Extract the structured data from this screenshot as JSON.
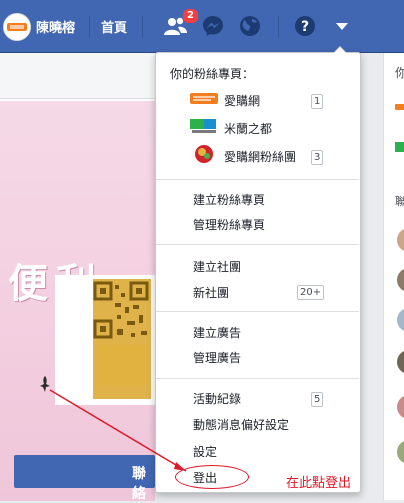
{
  "topbar": {
    "user_name": "陳曉榕",
    "home_label": "首頁",
    "friend_request_count": "2",
    "icons": [
      "friends-icon",
      "messenger-icon",
      "globe-icon",
      "help-icon",
      "dropdown-arrow-icon"
    ],
    "bg_color": "#4267b2"
  },
  "main": {
    "banner_text": "便利 ",
    "button_label": "聯絡"
  },
  "right_sidebar": {
    "header_char": "你",
    "section_char": "聯"
  },
  "menu": {
    "pages_heading": "你的粉絲專頁：",
    "pages": [
      {
        "name": "愛購網",
        "count": "1",
        "logo_text": "愛購網"
      },
      {
        "name": "米蘭之都",
        "count": "",
        "logo_text": "米蘭"
      },
      {
        "name": "愛購網粉絲團",
        "count": "3",
        "logo_text": ""
      }
    ],
    "group1": [
      "建立粉絲專頁",
      "管理粉絲專頁"
    ],
    "group2": [
      "建立社團",
      "新社團"
    ],
    "new_group_count": "20+",
    "group3": [
      "建立廣告",
      "管理廣告"
    ],
    "group4": [
      "活動紀錄",
      "動態消息偏好設定",
      "設定",
      "登出"
    ],
    "activity_count": "5"
  },
  "annotation": {
    "text": "在此點登出",
    "color": "#e0192a"
  }
}
